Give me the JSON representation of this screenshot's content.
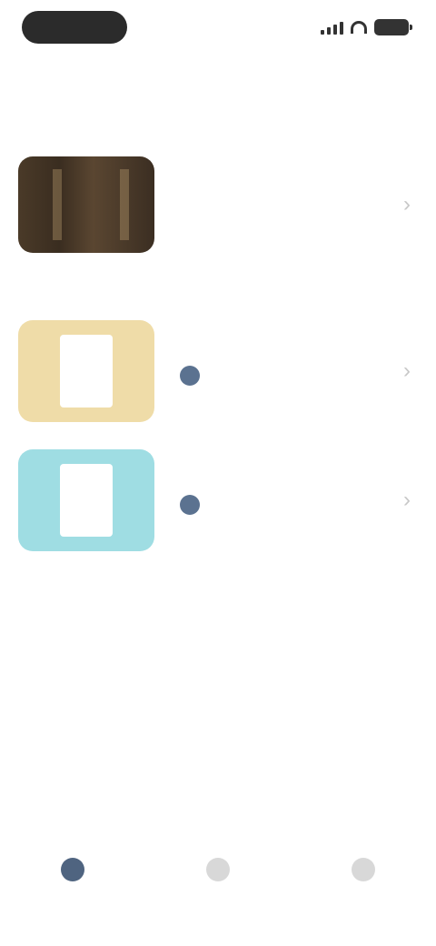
{
  "status_bar": {
    "time": "",
    "icons": [
      "signal-icon",
      "wifi-icon",
      "battery-icon"
    ]
  },
  "header": {
    "title": ""
  },
  "sections": [
    {
      "label": "",
      "items": [
        {
          "title": "",
          "meta": "",
          "thumbnail": "dark-photo",
          "color": "#4a3a28"
        }
      ]
    },
    {
      "label": "",
      "items": [
        {
          "title": "",
          "meta": "",
          "thumbnail": "document",
          "color": "#efdca8"
        },
        {
          "title": "",
          "meta": "",
          "thumbnail": "document",
          "color": "#9fdde3"
        }
      ]
    }
  ],
  "bottom_nav": {
    "items": [
      {
        "label": "",
        "icon": "home-icon",
        "active": true
      },
      {
        "label": "",
        "icon": "browse-icon",
        "active": false
      },
      {
        "label": "",
        "icon": "profile-icon",
        "active": false
      }
    ]
  },
  "colors": {
    "accent": "#4f6480",
    "chevron": "#c8c8c8",
    "section_label": "#999999"
  }
}
